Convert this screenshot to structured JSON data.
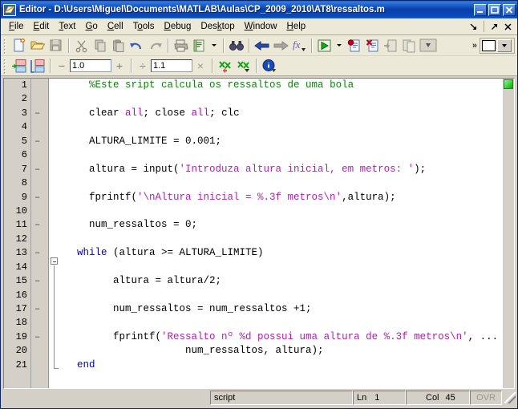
{
  "window": {
    "title": "Editor - D:\\Users\\Miguel\\Documents\\MATLAB\\Aulas\\CP_2009_2010\\AT8\\ressaltos.m",
    "icon": "editor-document-icon",
    "minimize_label": "_",
    "maximize_label": "□",
    "close_label": "✕",
    "accent_color": "#0a3fa8",
    "chrome_color": "#d4d0c8"
  },
  "menubar": {
    "items": [
      {
        "label": "File",
        "mnemonic": "F"
      },
      {
        "label": "Edit",
        "mnemonic": "E"
      },
      {
        "label": "Text",
        "mnemonic": "T"
      },
      {
        "label": "Go",
        "mnemonic": "G"
      },
      {
        "label": "Cell",
        "mnemonic": "C"
      },
      {
        "label": "Tools",
        "mnemonic": "o"
      },
      {
        "label": "Debug",
        "mnemonic": "D"
      },
      {
        "label": "Desktop",
        "mnemonic": "k"
      },
      {
        "label": "Window",
        "mnemonic": "W"
      },
      {
        "label": "Help",
        "mnemonic": "H"
      }
    ],
    "undock_label": "↘",
    "float_label": "↗",
    "close_label": "✕"
  },
  "toolbar_main": {
    "buttons": [
      {
        "name": "new-file-icon",
        "tooltip": "New"
      },
      {
        "name": "open-folder-icon",
        "tooltip": "Open"
      },
      {
        "name": "save-icon",
        "tooltip": "Save"
      },
      {
        "name": "cut-scissors-icon",
        "tooltip": "Cut"
      },
      {
        "name": "copy-icon",
        "tooltip": "Copy"
      },
      {
        "name": "paste-icon",
        "tooltip": "Paste"
      },
      {
        "name": "undo-arrow-icon",
        "tooltip": "Undo"
      },
      {
        "name": "redo-arrow-icon",
        "tooltip": "Redo"
      },
      {
        "name": "print-icon",
        "tooltip": "Print"
      },
      {
        "name": "print-preview-icon",
        "tooltip": "Print selection"
      },
      {
        "name": "binoculars-icon",
        "tooltip": "Find"
      },
      {
        "name": "back-arrow-icon",
        "tooltip": "Back"
      },
      {
        "name": "forward-arrow-icon",
        "tooltip": "Forward"
      },
      {
        "name": "function-browser-icon",
        "tooltip": "Function browser"
      },
      {
        "name": "run-play-icon",
        "tooltip": "Run"
      },
      {
        "name": "set-breakpoint-icon",
        "tooltip": "Set/clear breakpoint"
      },
      {
        "name": "clear-breakpoints-icon",
        "tooltip": "Clear all breakpoints"
      },
      {
        "name": "step-in-icon",
        "tooltip": "Step in"
      },
      {
        "name": "step-out-icon",
        "tooltip": "Step out"
      },
      {
        "name": "stack-dropdown-icon",
        "tooltip": "Stack"
      }
    ],
    "overflow_label": "»",
    "color_swatch": "#ffffff"
  },
  "toolbar_cell": {
    "buttons": [
      {
        "name": "insert-cell-divider-icon",
        "tooltip": "Insert cell divider"
      },
      {
        "name": "insert-cell-divider-selection-icon",
        "tooltip": "Insert cell divider at selection"
      }
    ],
    "minus_label": "−",
    "decrement_value": "1.0",
    "plus_label": "+",
    "divide_label": "÷",
    "divide_value": "1.1",
    "times_label": "×",
    "eval_cell_icon": "evaluate-cell-icon",
    "eval_cell_advance_icon": "evaluate-cell-advance-icon",
    "info_icon": "info-icon"
  },
  "editor": {
    "ok_marker_color": "#35d035",
    "lines": [
      {
        "n": "1",
        "bp": "",
        "code": "    %Este sript calcula os ressaltos de uma bola"
      },
      {
        "n": "2",
        "bp": "",
        "code": ""
      },
      {
        "n": "3",
        "bp": "–",
        "code": "    clear all; close all; clc"
      },
      {
        "n": "4",
        "bp": "",
        "code": ""
      },
      {
        "n": "5",
        "bp": "–",
        "code": "    ALTURA_LIMITE = 0.001;"
      },
      {
        "n": "6",
        "bp": "",
        "code": ""
      },
      {
        "n": "7",
        "bp": "–",
        "code": "    altura = input('Introduza altura inicial, em metros: ');"
      },
      {
        "n": "8",
        "bp": "",
        "code": ""
      },
      {
        "n": "9",
        "bp": "–",
        "code": "    fprintf('\\nAltura inicial = %.3f metros\\n',altura);"
      },
      {
        "n": "10",
        "bp": "",
        "code": ""
      },
      {
        "n": "11",
        "bp": "–",
        "code": "    num_ressaltos = 0;"
      },
      {
        "n": "12",
        "bp": "",
        "code": ""
      },
      {
        "n": "13",
        "bp": "–",
        "code": "  while (altura >= ALTURA_LIMITE)"
      },
      {
        "n": "14",
        "bp": "",
        "code": ""
      },
      {
        "n": "15",
        "bp": "–",
        "code": "        altura = altura/2;"
      },
      {
        "n": "16",
        "bp": "",
        "code": ""
      },
      {
        "n": "17",
        "bp": "–",
        "code": "        num_ressaltos = num_ressaltos +1;"
      },
      {
        "n": "18",
        "bp": "",
        "code": ""
      },
      {
        "n": "19",
        "bp": "–",
        "code": "        fprintf('Ressalto nº %d possui uma altura de %.3f metros\\n', ..."
      },
      {
        "n": "20",
        "bp": "",
        "code": "                    num_ressaltos, altura);"
      },
      {
        "n": "21",
        "bp": "",
        "code": "  end"
      }
    ],
    "syntax_colors": {
      "keyword": "#0000c8",
      "string": "#b020b0",
      "comment": "#108010",
      "plain": "#000000"
    }
  },
  "statusbar": {
    "file_type": "script",
    "line_label": "Ln",
    "line_value": "1",
    "column_label": "Col",
    "column_value": "45",
    "overwrite_label": "OVR"
  }
}
